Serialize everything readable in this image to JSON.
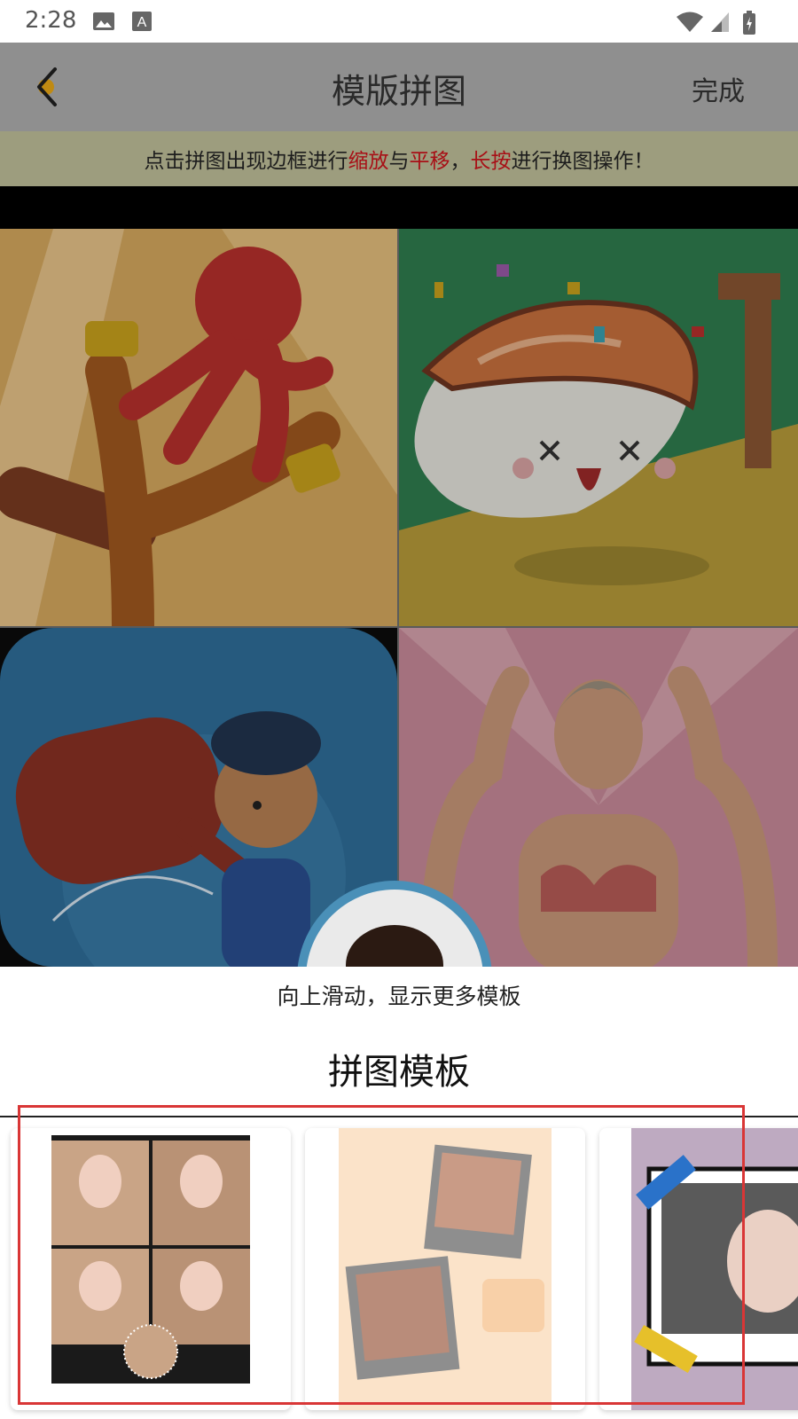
{
  "status_bar": {
    "time": "2:28",
    "icons": [
      "image-icon",
      "text-a-icon",
      "wifi-icon",
      "signal-icon",
      "battery-charging-icon"
    ]
  },
  "header": {
    "back_icon": "chevron-left-icon",
    "title": "模版拼图",
    "done_label": "完成"
  },
  "hint": {
    "part1": "点击拼图出现边框进行 ",
    "scale": "缩放",
    "part2": "与 ",
    "pan": "平移",
    "part3": "， ",
    "longpress": "长按",
    "part4": "进行换图操作！"
  },
  "collage": {
    "cells": [
      "slingshot-game-image",
      "sushi-cartoon-image",
      "police-hammer-game-image",
      "fitness-woman-image"
    ]
  },
  "swipe_hint": "向上滑动，显示更多模板",
  "templates": {
    "title": "拼图模板",
    "items": [
      "template-grid-photos",
      "template-polaroid-pastel",
      "template-taped-frame"
    ]
  },
  "colors": {
    "header_bg": "#8f8f8f",
    "hint_bg": "#9d9d7e",
    "accent_red": "#a80f16",
    "highlight_red": "#d93636"
  }
}
